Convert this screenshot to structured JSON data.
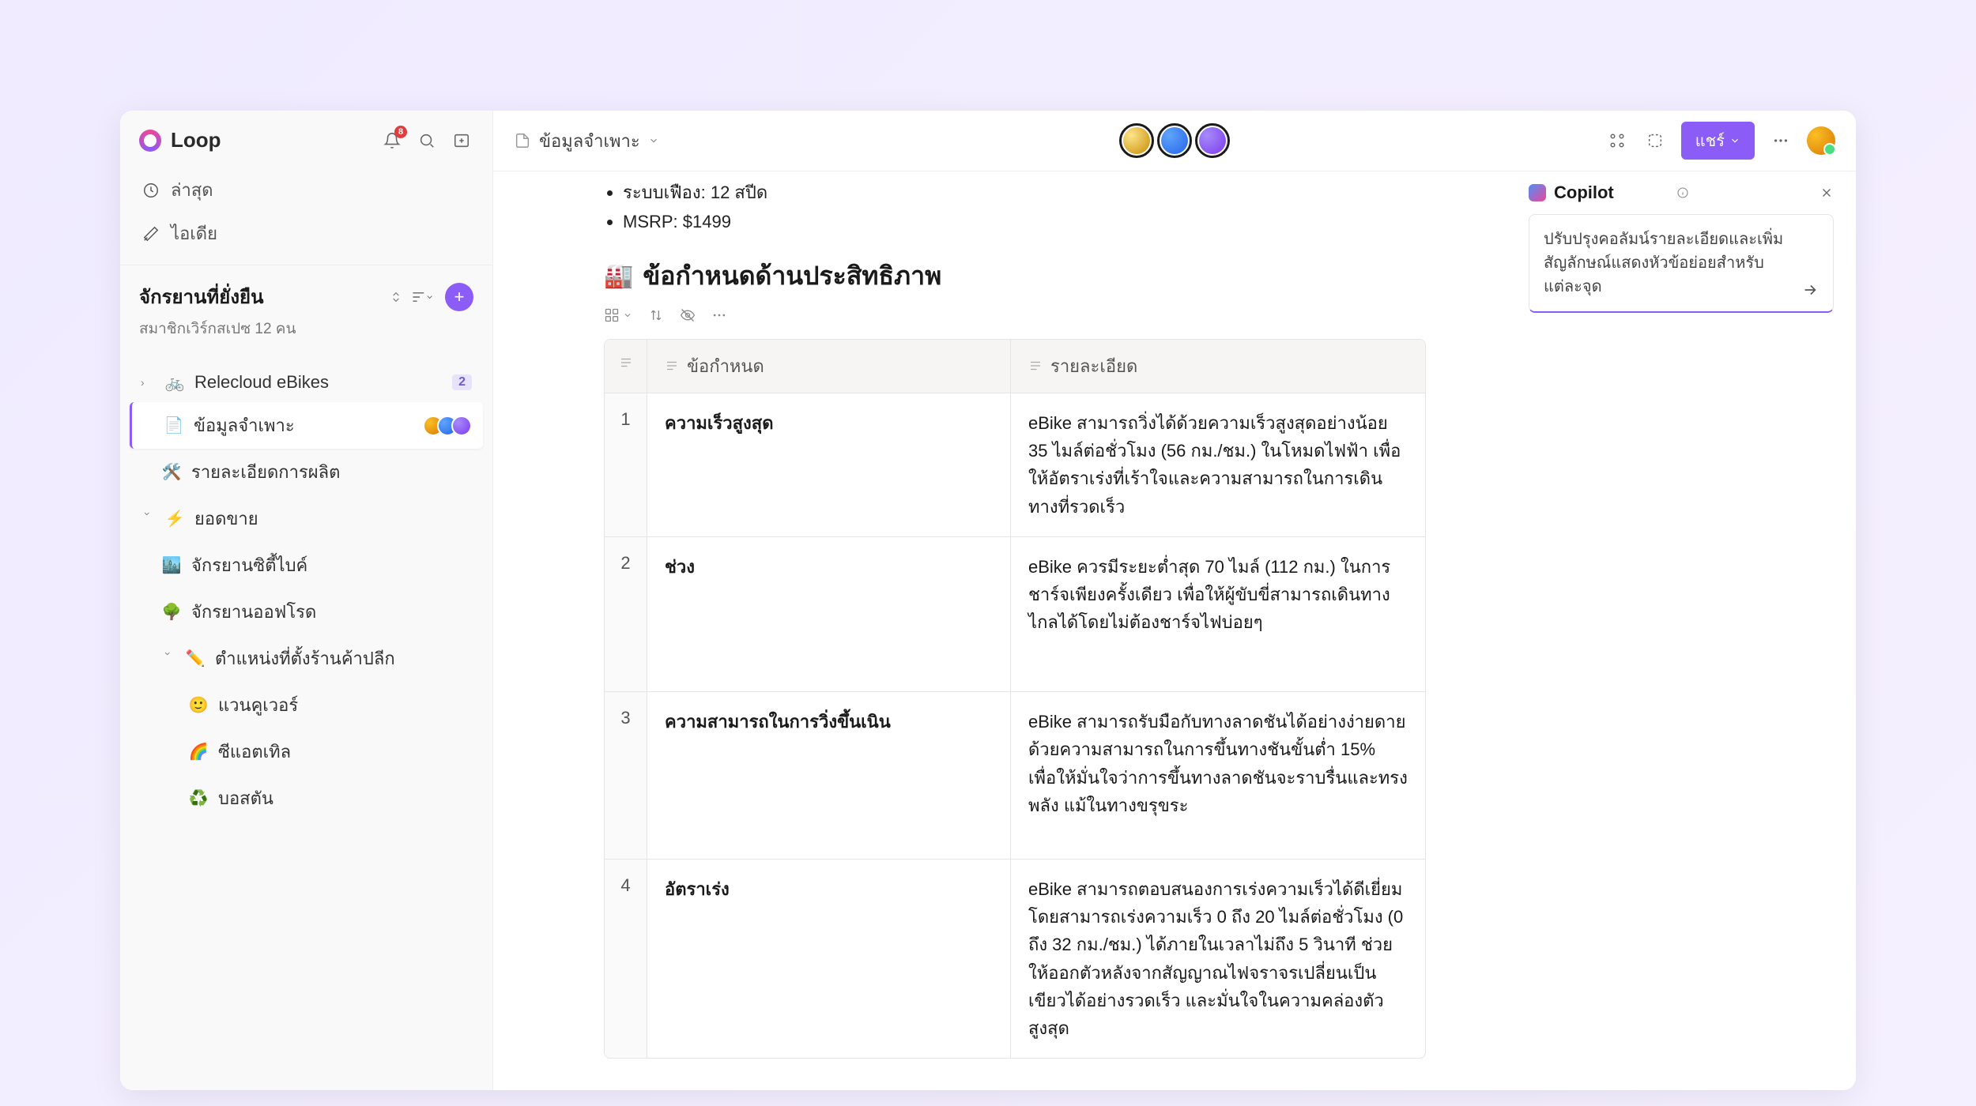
{
  "app_name": "Loop",
  "notif_count": "8",
  "nav": {
    "recent": "ล่าสุด",
    "ideas": "ไอเดีย"
  },
  "workspace": {
    "title": "จักรยานที่ยั่งยืน",
    "subtitle": "สมาชิกเวิร์กสเปซ 12 คน"
  },
  "tree": {
    "item1": {
      "label": "Relecloud eBikes",
      "badge": "2"
    },
    "item2": {
      "label": "ข้อมูลจำเพาะ"
    },
    "item3": {
      "label": "รายละเอียดการผลิต"
    },
    "item4": {
      "label": "ยอดขาย"
    },
    "item5": {
      "label": "จักรยานซิตี้ไบค์"
    },
    "item6": {
      "label": "จักรยานออฟโรด"
    },
    "item7": {
      "label": "ตำแหน่งที่ตั้งร้านค้าปลีก"
    },
    "item8": {
      "label": "แวนคูเวอร์"
    },
    "item9": {
      "label": "ซีแอตเทิล"
    },
    "item10": {
      "label": "บอสตัน"
    }
  },
  "topbar": {
    "doc_title": "ข้อมูลจำเพาะ",
    "share": "แชร์"
  },
  "doc": {
    "bullets": {
      "b1": "ระบบเฟือง: 12 สปีด",
      "b2": "MSRP: $1499"
    },
    "section_heading": "ข้อกำหนดด้านประสิทธิภาพ",
    "table": {
      "col_a": "ข้อกำหนด",
      "col_b": "รายละเอียด",
      "rows": [
        {
          "n": "1",
          "a": "ความเร็วสูงสุด",
          "b": "eBike สามารถวิ่งได้ด้วยความเร็วสูงสุดอย่างน้อย 35 ไมล์ต่อชั่วโมง (56 กม./ชม.) ในโหมดไฟฟ้า เพื่อให้อัตราเร่งที่เร้าใจและความสามารถในการเดินทางที่รวดเร็ว"
        },
        {
          "n": "2",
          "a": "ช่วง",
          "b": "eBike ควรมีระยะต่ำสุด 70 ไมล์ (112 กม.) ในการชาร์จเพียงครั้งเดียว เพื่อให้ผู้ขับขี่สามารถเดินทางไกลได้โดยไม่ต้องชาร์จไฟบ่อยๆ"
        },
        {
          "n": "3",
          "a": "ความสามารถในการวิ่งขึ้นเนิน",
          "b": "eBike สามารถรับมือกับทางลาดชันได้อย่างง่ายดาย ด้วยความสามารถในการขึ้นทางชันขั้นต่ำ 15% เพื่อให้มั่นใจว่าการขึ้นทางลาดชันจะราบรื่นและทรงพลัง แม้ในทางขรุขระ"
        },
        {
          "n": "4",
          "a": "อัตราเร่ง",
          "b": "eBike สามารถตอบสนองการเร่งความเร็วได้ดีเยี่ยม โดยสามารถเร่งความเร็ว 0 ถึง 20 ไมล์ต่อชั่วโมง (0 ถึง 32 กม./ชม.) ได้ภายในเวลาไม่ถึง 5 วินาที ช่วยให้ออกตัวหลังจากสัญญาณไฟจราจรเปลี่ยนเป็นเขียวได้อย่างรวดเร็ว และมั่นใจในความคล่องตัวสูงสุด"
        }
      ]
    }
  },
  "copilot": {
    "title": "Copilot",
    "prompt": "ปรับปรุงคอลัมน์รายละเอียดและเพิ่มสัญลักษณ์แสดงหัวข้อย่อยสำหรับแต่ละจุด"
  }
}
